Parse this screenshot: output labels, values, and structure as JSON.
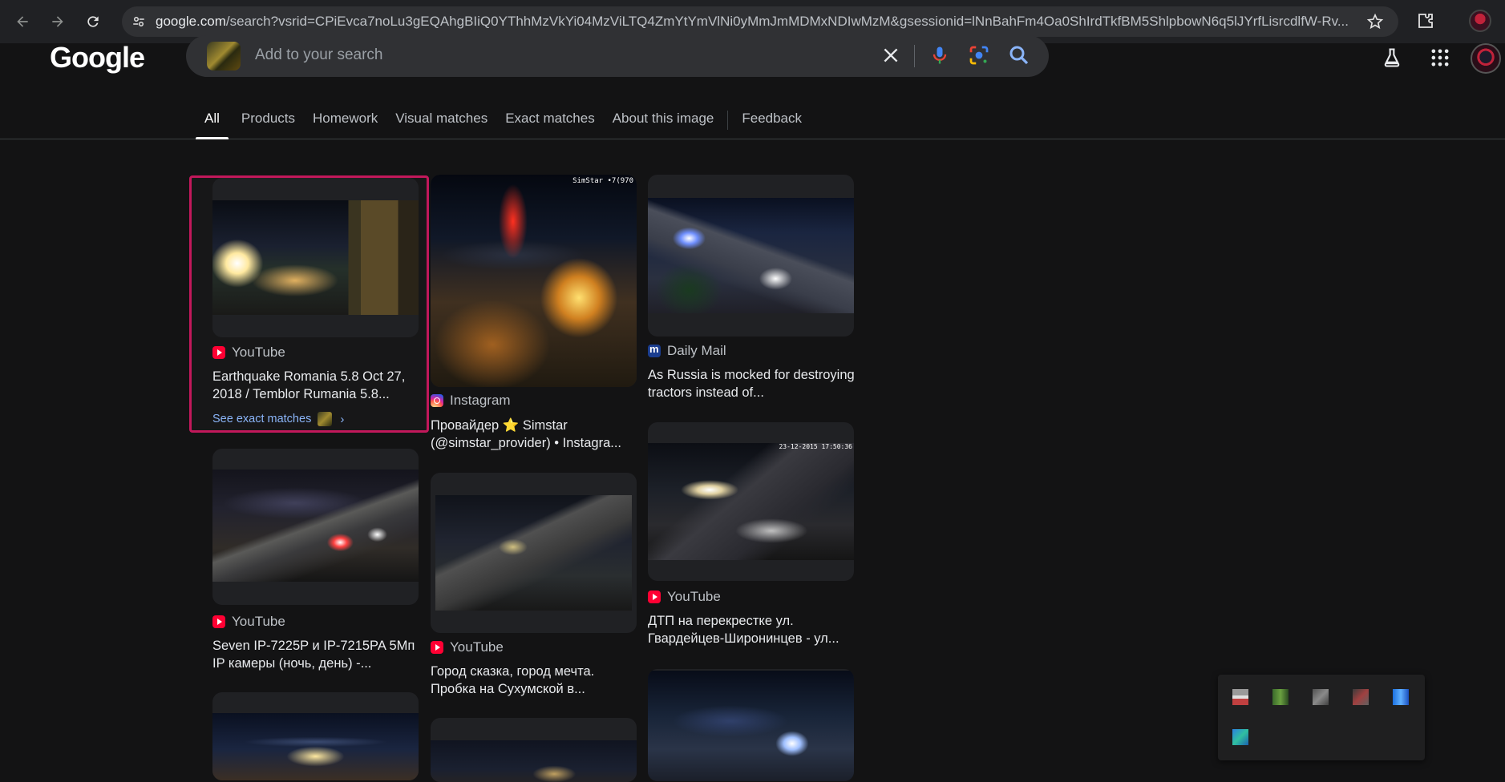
{
  "browser": {
    "url_host": "google.com",
    "url_path": "/search?vsrid=CPiEvca7noLu3gEQAhgBIiQ0YThhMzVkYi04MzViLTQ4ZmYtYmVlNi0yMmJmMDMxNDIwMzM&gsessionid=lNnBahFm4Oa0ShIrdTkfBM5ShlpbowN6q5lJYrfLisrcdlfW-Rv..."
  },
  "header": {
    "logo": "Google",
    "search_placeholder": "Add to your search"
  },
  "tabs": [
    "All",
    "Products",
    "Homework",
    "Visual matches",
    "Exact matches",
    "About this image",
    "Feedback"
  ],
  "results": [
    {
      "source": "YouTube",
      "title": "Earthquake Romania 5.8 Oct 27, 2018 / Temblor Rumania 5.8...",
      "exact_link": "See exact matches"
    },
    {
      "source": "Instagram",
      "title": "Провайдер ⭐ Simstar (@simstar_provider) • Instagra..."
    },
    {
      "source": "Daily Mail",
      "title": "As Russia is mocked for destroying tractors instead of..."
    },
    {
      "source": "YouTube",
      "title": "Seven IP-7225P и IP-7215PA 5Мп IP камеры (ночь, день) -..."
    },
    {
      "source": "YouTube",
      "title": "Город сказка, город мечта. Пробка на Сухумской в..."
    },
    {
      "source": "YouTube",
      "title": "ДТП на перекрестке ул. Гвардейцев-Широнинцев - ул..."
    }
  ],
  "image_overlays": {
    "simstar": "SimStar •7(970",
    "yt_date": "23-12-2015 17:50:36"
  }
}
